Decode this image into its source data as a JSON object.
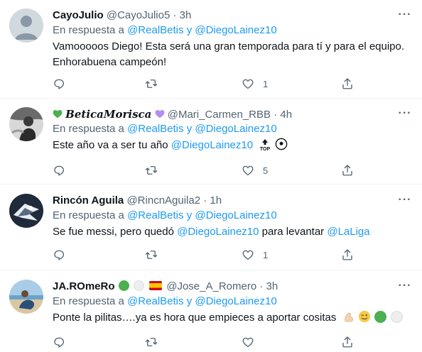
{
  "tweets": [
    {
      "name": "CayoJulio",
      "handle": "@CayoJulio5",
      "dot": "·",
      "time": "3h",
      "reply_prefix": "En respuesta a",
      "reply_to_1": "@RealBetis",
      "reply_and": "y",
      "reply_to_2": "@DiegoLainez10",
      "text_1": "Vamooooos Diego! Esta será una gran temporada para tí y para el equipo.",
      "text_2": "Enhorabuena campeón!",
      "likes": "1"
    },
    {
      "name": "BeticaMorisca",
      "handle": "@Mari_Carmen_RBB",
      "dot": "·",
      "time": "4h",
      "reply_prefix": "En respuesta a",
      "reply_to_1": "@RealBetis",
      "reply_and": "y",
      "reply_to_2": "@DiegoLainez10",
      "text_1": "Este año va a ser tu año",
      "mention": "@DiegoLainez10",
      "likes": "5"
    },
    {
      "name": "Rincón Aguila",
      "handle": "@RincnAguila2",
      "dot": "·",
      "time": "1h",
      "reply_prefix": "En respuesta a",
      "reply_to_1": "@RealBetis",
      "reply_and": "y",
      "reply_to_2": "@DiegoLainez10",
      "text_1": "Se fue messi, pero quedó",
      "mention": "@DiegoLainez10",
      "text_2": "para levantar",
      "mention_2": "@LaLiga",
      "likes": "1"
    },
    {
      "name": "JA.ROmeRo",
      "handle": "@Jose_A_Romero",
      "dot": "·",
      "time": "3h",
      "reply_prefix": "En respuesta a",
      "reply_to_1": "@RealBetis",
      "reply_and": "y",
      "reply_to_2": "@DiegoLainez10",
      "text_1": "Ponte la pilitas….ya es hora que empieces a aportar cositas"
    }
  ],
  "icons": {
    "more": "more-icon",
    "reply": "reply-icon",
    "retweet": "retweet-icon",
    "like": "like-icon",
    "share": "share-icon"
  },
  "colors": {
    "link": "#1d9bf0",
    "secondary": "#536471",
    "green": "#4caf50",
    "purple": "#b48ef0"
  }
}
